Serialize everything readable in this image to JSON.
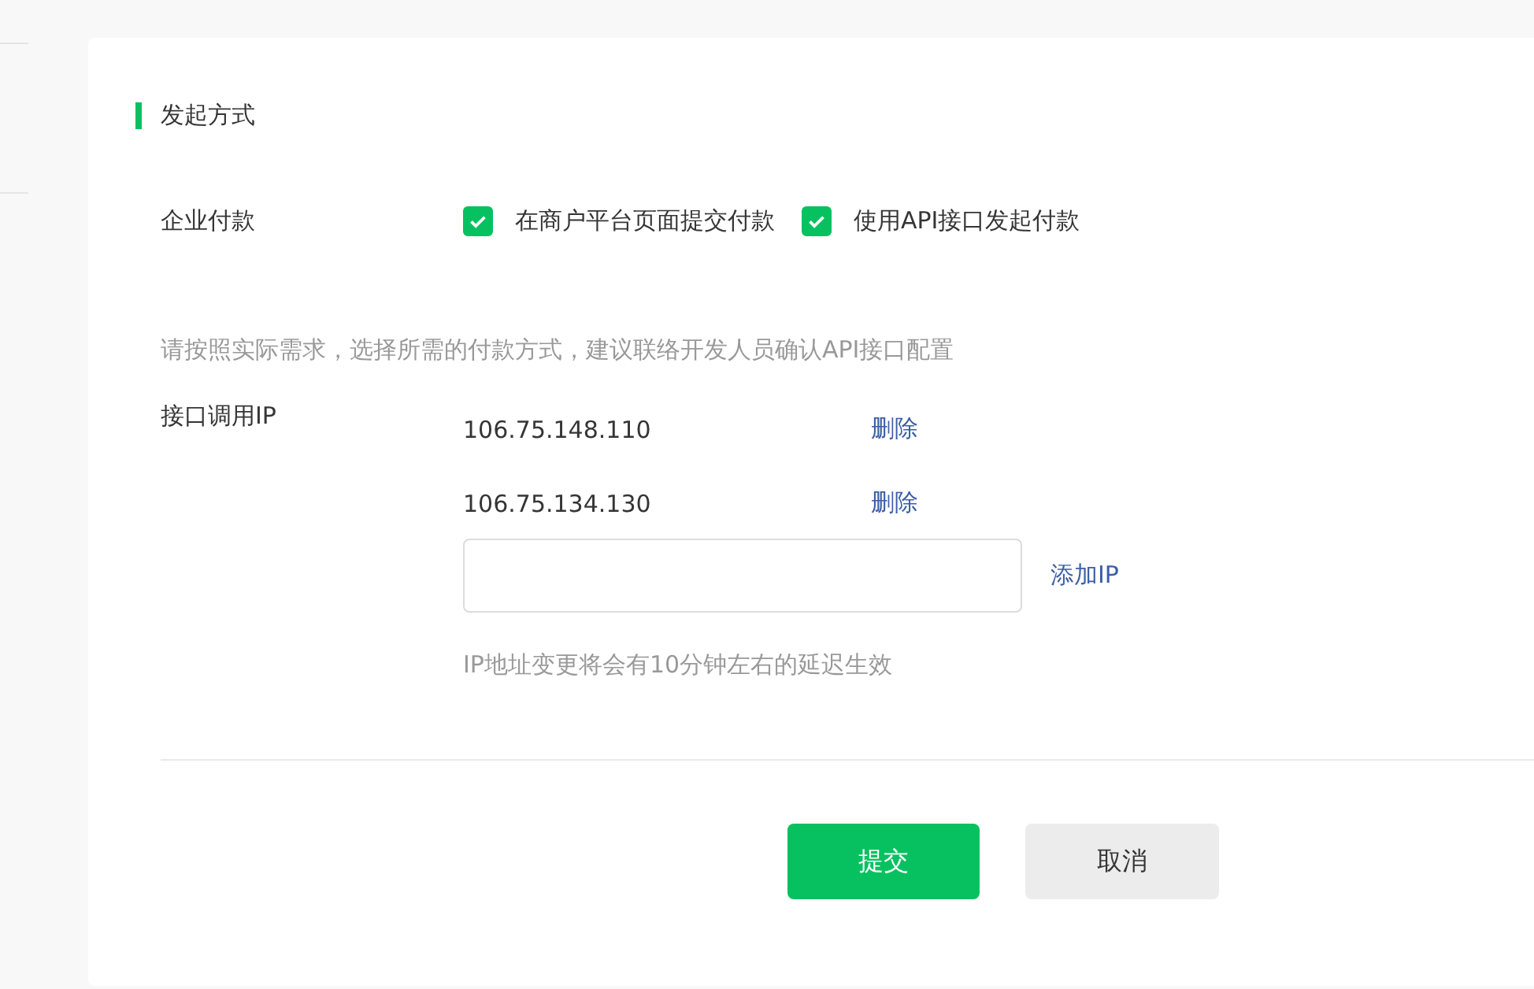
{
  "section_title": "发起方式",
  "payment": {
    "label": "企业付款",
    "options": [
      {
        "label": "在商户平台页面提交付款",
        "checked": true
      },
      {
        "label": "使用API接口发起付款",
        "checked": true
      }
    ]
  },
  "hint": "请按照实际需求，选择所需的付款方式，建议联络开发人员确认API接口配置",
  "ip": {
    "label": "接口调用IP",
    "entries": [
      {
        "address": "106.75.148.110",
        "action": "删除"
      },
      {
        "address": "106.75.134.130",
        "action": "删除"
      }
    ],
    "add_action": "添加IP",
    "note": "IP地址变更将会有10分钟左右的延迟生效"
  },
  "buttons": [
    {
      "label": "提交",
      "kind": "primary"
    },
    {
      "label": "取消",
      "kind": "secondary"
    }
  ]
}
